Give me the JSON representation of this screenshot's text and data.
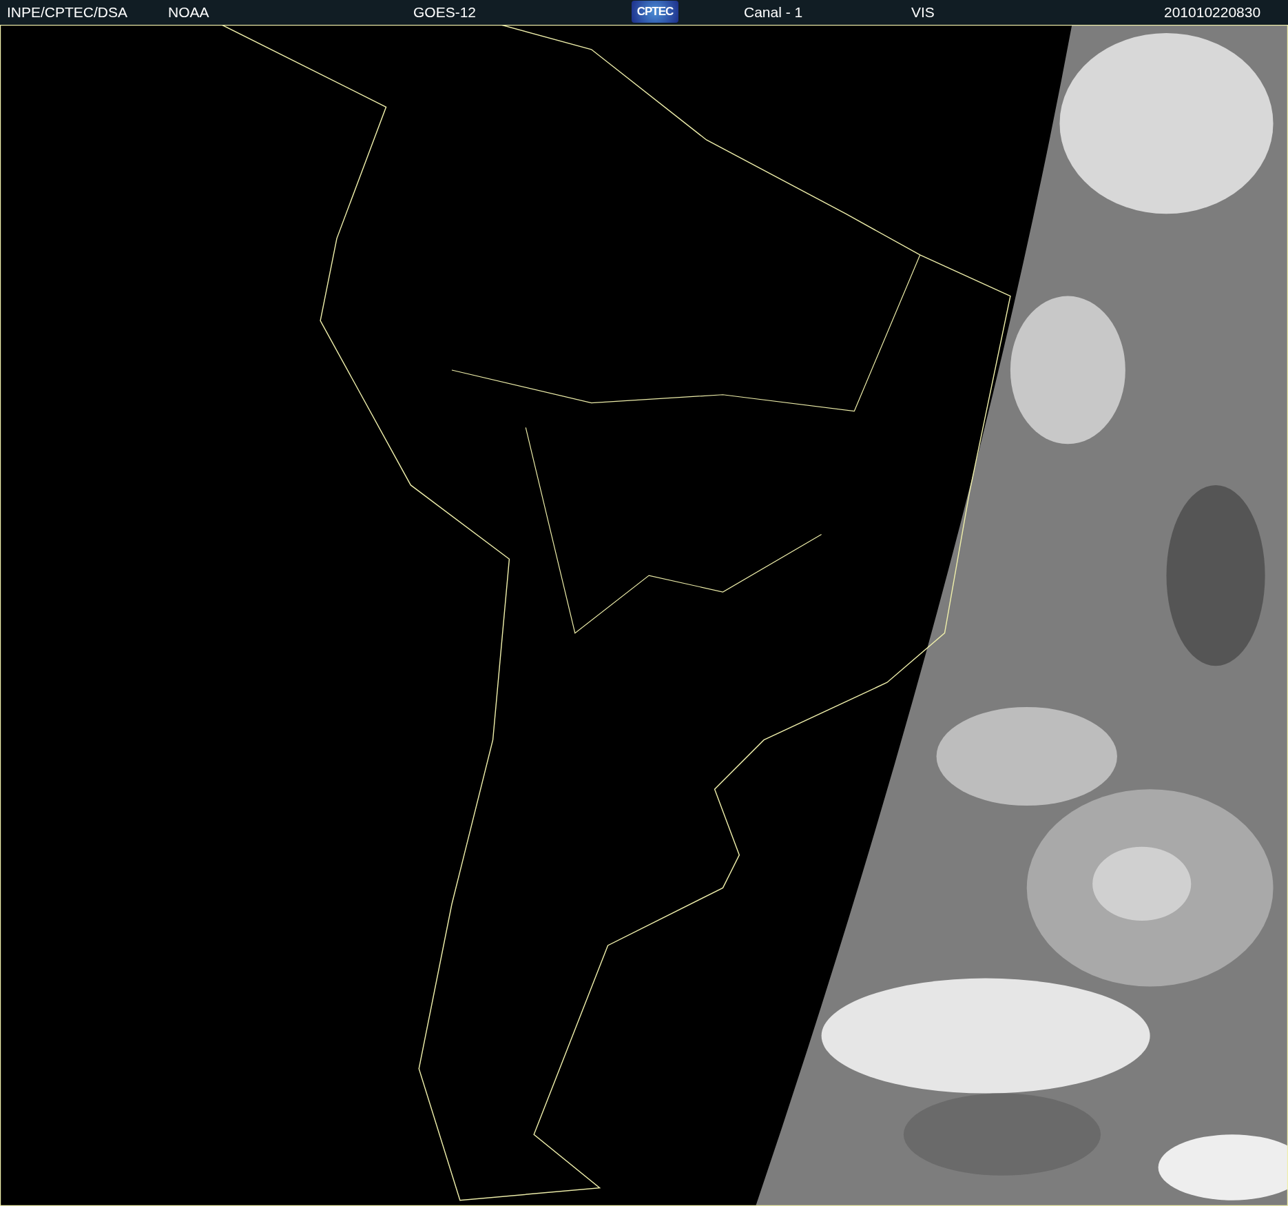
{
  "header": {
    "items": [
      {
        "kind": "text",
        "text": "INPE/CPTEC/DSA"
      },
      {
        "kind": "text",
        "text": "NOAA"
      },
      {
        "kind": "text",
        "text": "GOES-12"
      },
      {
        "kind": "logo",
        "text": "CPTEC"
      },
      {
        "kind": "text",
        "text": "Canal - 1"
      },
      {
        "kind": "text",
        "text": "VIS"
      },
      {
        "kind": "text",
        "text": "201010220830"
      }
    ]
  }
}
